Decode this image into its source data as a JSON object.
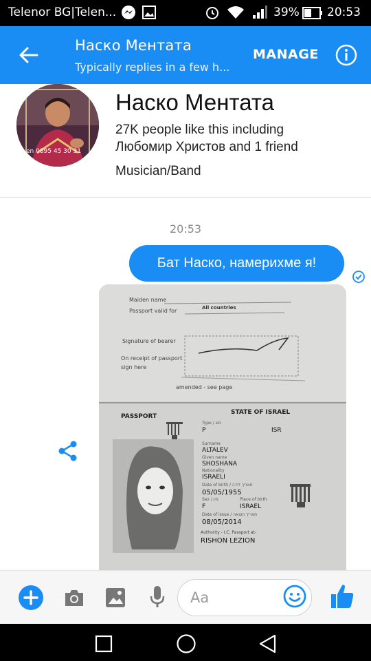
{
  "status_bar": {
    "carrier": "Telenor BG|Telen...",
    "battery_percent": "39%",
    "time": "20:53",
    "icons": [
      "messenger-icon",
      "image-icon",
      "alarm-icon",
      "wifi-icon",
      "signal-icon",
      "battery-icon"
    ]
  },
  "header": {
    "title": "Наско Ментата",
    "subtitle": "Typically replies in a few h...",
    "manage_label": "MANAGE",
    "accent_color": "#1a8df5"
  },
  "profile": {
    "name": "Наско Ментата",
    "likes_line1": "27K people like this including",
    "likes_line2": "Любомир Христов and 1 friend",
    "category": "Musician/Band",
    "avatar_caption": "en 0895 45 30 31"
  },
  "conversation": {
    "timestamp": "20:53",
    "message": "Бат Наско, намерихме я!"
  },
  "passport": {
    "maiden_name_label": "Maiden name",
    "valid_for_label": "Passport valid for",
    "valid_for_value": "All countries",
    "signature_label": "Signature of bearer",
    "receipt_label": "On receipt of passport",
    "sign_here_label": "sign here",
    "amended_label": "amended - see page",
    "header_label": "PASSPORT",
    "state": "STATE OF ISRAEL",
    "type": "P",
    "code": "ISR",
    "surname": "ALTALEV",
    "given_name": "SHOSHANA",
    "nationality": "ISRAELI",
    "dob": "05/05/1955",
    "sex": "F",
    "place_of_birth": "ISRAEL",
    "date_of_issue": "08/05/2014",
    "authority_label": "Authority - I.C. Passport at-",
    "authority": "RISHON LEZION"
  },
  "composer": {
    "placeholder": "Aa"
  }
}
